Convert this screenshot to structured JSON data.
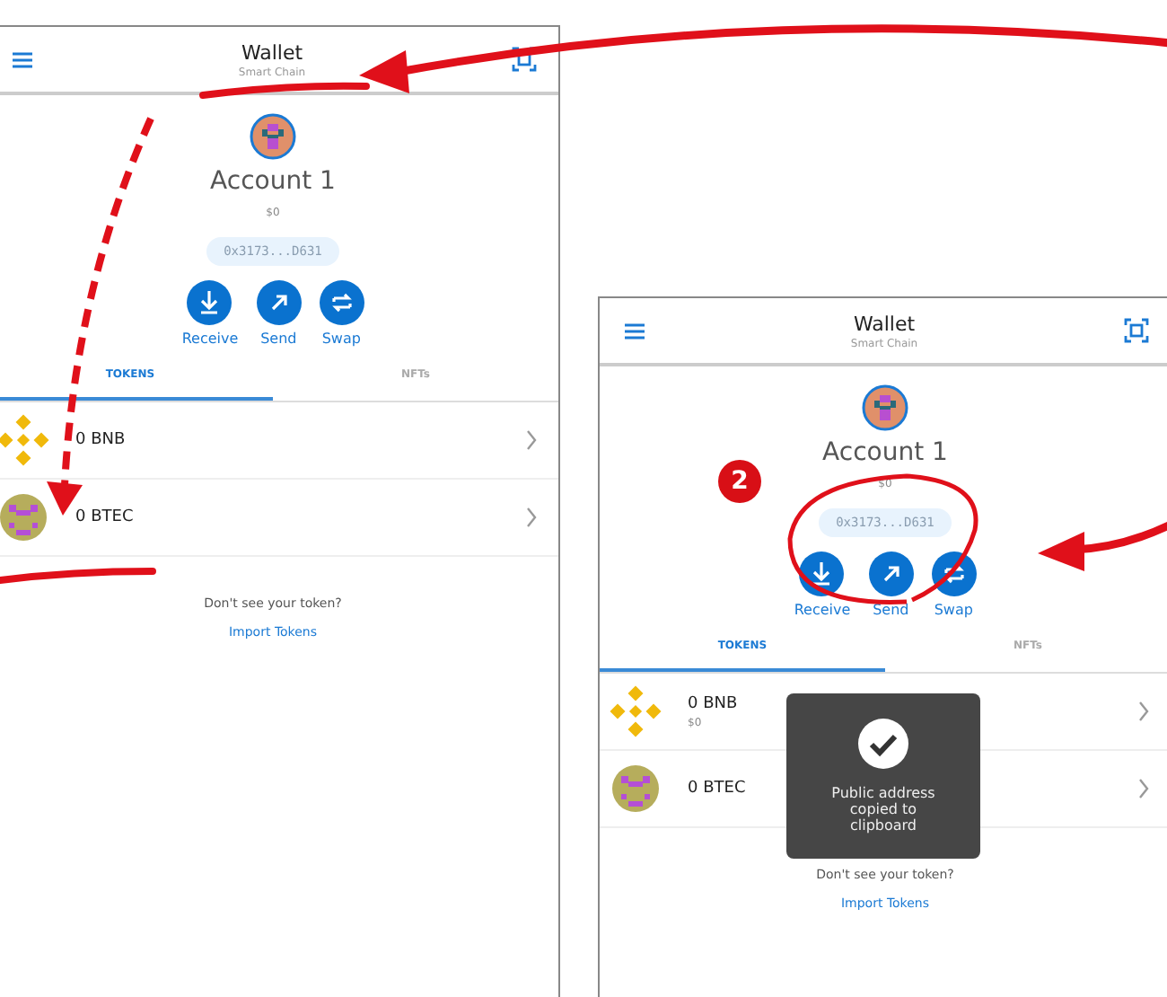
{
  "screens": [
    {
      "header": {
        "title": "Wallet",
        "subtitle": "Smart Chain"
      },
      "account": {
        "name": "Account 1",
        "balance": "$0",
        "address": "0x3173...D631"
      },
      "actions": [
        {
          "kind": "receive",
          "label": "Receive"
        },
        {
          "kind": "send",
          "label": "Send"
        },
        {
          "kind": "swap",
          "label": "Swap"
        }
      ],
      "tabs": [
        {
          "label": "TOKENS",
          "selected": true
        },
        {
          "label": "NFTs",
          "selected": false
        }
      ],
      "tokens": [
        {
          "kind": "bnb",
          "amount": "0 BNB"
        },
        {
          "kind": "btec",
          "amount": "0 BTEC"
        }
      ],
      "footer": {
        "prompt": "Don't see your token?",
        "link": "Import Tokens"
      }
    },
    {
      "header": {
        "title": "Wallet",
        "subtitle": "Smart Chain"
      },
      "account": {
        "name": "Account 1",
        "balance": "$0",
        "address": "0x3173...D631"
      },
      "actions": [
        {
          "kind": "receive",
          "label": "Receive"
        },
        {
          "kind": "send",
          "label": "Send"
        },
        {
          "kind": "swap",
          "label": "Swap"
        }
      ],
      "tabs": [
        {
          "label": "TOKENS",
          "selected": true
        },
        {
          "label": "NFTs",
          "selected": false
        }
      ],
      "tokens": [
        {
          "kind": "bnb",
          "amount": "0 BNB",
          "value": "$0"
        },
        {
          "kind": "btec",
          "amount": "0 BTEC"
        }
      ],
      "footer": {
        "prompt": "Don't see your token?",
        "link": "Import Tokens"
      },
      "toast": {
        "message": "Public address copied to clipboard"
      }
    }
  ],
  "step_badge": "2"
}
